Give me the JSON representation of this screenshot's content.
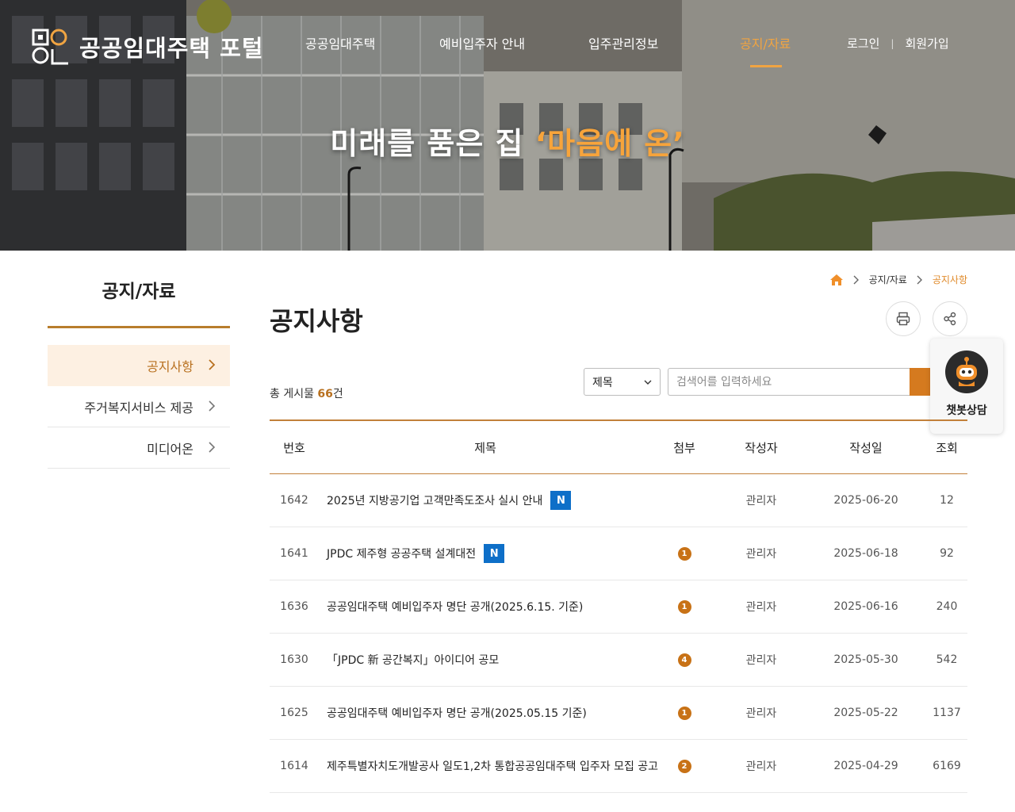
{
  "header": {
    "logo_text": "공공임대주택 포털",
    "nav": [
      {
        "label": "공공임대주택"
      },
      {
        "label": "예비입주자 안내"
      },
      {
        "label": "입주관리정보"
      },
      {
        "label": "공지/자료"
      }
    ],
    "active_nav": "공지/자료",
    "login": "로그인",
    "signup": "회원가입",
    "separator": "|"
  },
  "hero": {
    "tagline_main": "미래를 품은 집 ",
    "tagline_highlight": "‘마음에 온’"
  },
  "sidebar": {
    "title": "공지/자료",
    "items": [
      {
        "label": "공지사항",
        "active": true
      },
      {
        "label": "주거복지서비스 제공",
        "active": false
      },
      {
        "label": "미디어온",
        "active": false
      }
    ]
  },
  "breadcrumb": {
    "home_icon": "home-icon",
    "items": [
      "공지/자료",
      "공지사항"
    ]
  },
  "page": {
    "title": "공지사항",
    "total_prefix": "총 게시물 ",
    "total_count": "66",
    "total_suffix": "건"
  },
  "search": {
    "select_value": "제목",
    "placeholder": "검색어를 입력하세요"
  },
  "chatbot": {
    "label": "챗봇상담"
  },
  "table": {
    "headers": {
      "no": "번호",
      "title": "제목",
      "attach": "첨부",
      "writer": "작성자",
      "date": "작성일",
      "views": "조회"
    },
    "rows": [
      {
        "no": "1642",
        "title": "2025년 지방공기업 고객만족도조사 실시 안내",
        "new": "N",
        "attach": "",
        "writer": "관리자",
        "date": "2025-06-20",
        "views": "12"
      },
      {
        "no": "1641",
        "title": "JPDC 제주형 공공주택 설계대전",
        "new": "N",
        "attach": "1",
        "writer": "관리자",
        "date": "2025-06-18",
        "views": "92"
      },
      {
        "no": "1636",
        "title": "공공임대주택 예비입주자 명단 공개(2025.6.15. 기준)",
        "new": "",
        "attach": "1",
        "writer": "관리자",
        "date": "2025-06-16",
        "views": "240"
      },
      {
        "no": "1630",
        "title": "「JPDC 新 공간복지」아이디어 공모",
        "new": "",
        "attach": "4",
        "writer": "관리자",
        "date": "2025-05-30",
        "views": "542"
      },
      {
        "no": "1625",
        "title": "공공임대주택 예비입주자 명단 공개(2025.05.15 기준)",
        "new": "",
        "attach": "1",
        "writer": "관리자",
        "date": "2025-05-22",
        "views": "1137"
      },
      {
        "no": "1614",
        "title": "제주특별자치도개발공사 일도1,2차 통합공공임대주택 입주자 모집 공고",
        "new": "",
        "attach": "2",
        "writer": "관리자",
        "date": "2025-04-29",
        "views": "6169"
      }
    ]
  }
}
